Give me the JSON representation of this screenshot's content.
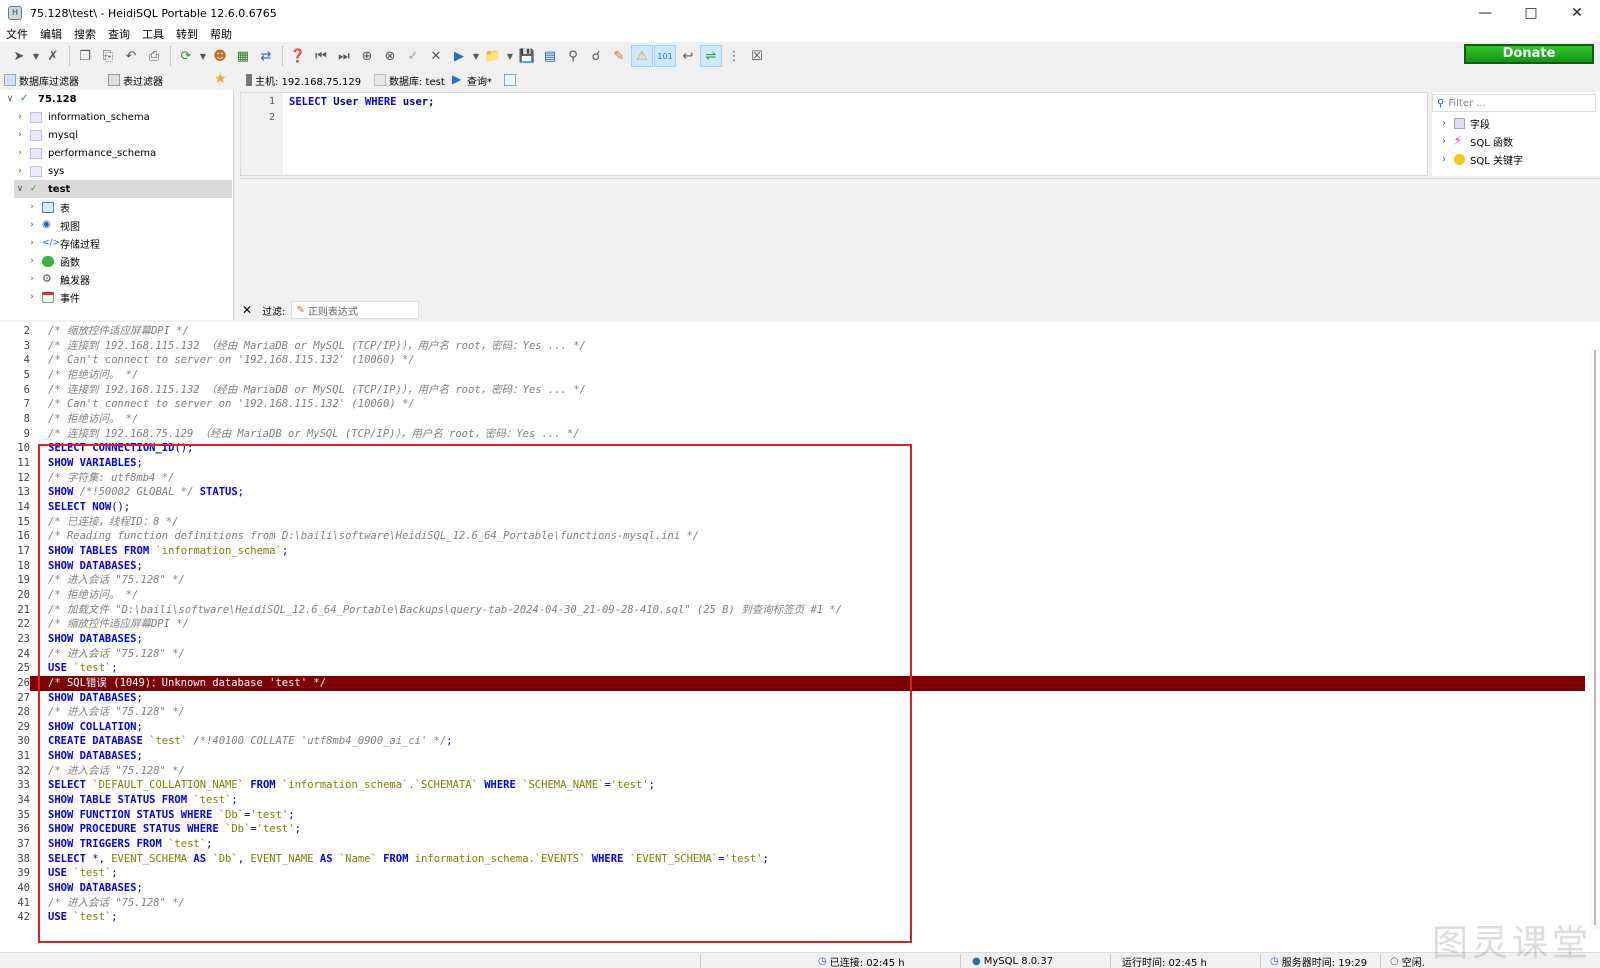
{
  "window": {
    "title": "75.128\\test\\ - HeidiSQL Portable 12.6.0.6765",
    "app_icon": "heidisql-icon"
  },
  "menu": [
    "文件",
    "编辑",
    "搜索",
    "查询",
    "工具",
    "转到",
    "帮助"
  ],
  "toolbar": {
    "donate_label": "Donate"
  },
  "tabs": {
    "db_filter": "数据库过滤器",
    "table_filter": "表过滤器",
    "host": "主机: 192.168.75.129",
    "database": "数据库: test",
    "query": "查询*"
  },
  "tree": {
    "root": "75.128",
    "databases": [
      "information_schema",
      "mysql",
      "performance_schema",
      "sys",
      "test"
    ],
    "selected": "test",
    "children": [
      "表",
      "视图",
      "存储过程",
      "函数",
      "触发器",
      "事件"
    ]
  },
  "editor": {
    "line_numbers": [
      "1",
      "2"
    ],
    "line1": {
      "kw1": "SELECT",
      "ident": "User",
      "kw2": "WHERE",
      "rest": "user;"
    }
  },
  "helpers": {
    "filter_placeholder": "Filter ...",
    "items": [
      "字段",
      "SQL 函数",
      "SQL 关键字"
    ]
  },
  "filterbar": {
    "label": "过滤:",
    "placeholder": "正则表达式"
  },
  "log": [
    {
      "n": "2",
      "parts": [
        [
          "c",
          "/* 缩放控件适应屏幕DPI */"
        ]
      ]
    },
    {
      "n": "3",
      "parts": [
        [
          "c",
          "/* 连接到 192.168.115.132 （经由 MariaDB or MySQL (TCP/IP)），用户名 root，密码：Yes ... */"
        ]
      ]
    },
    {
      "n": "4",
      "parts": [
        [
          "c",
          "/* Can't connect to server on '192.168.115.132' (10060) */"
        ]
      ]
    },
    {
      "n": "5",
      "parts": [
        [
          "c",
          "/* 拒绝访问。 */"
        ]
      ]
    },
    {
      "n": "6",
      "parts": [
        [
          "c",
          "/* 连接到 192.168.115.132 （经由 MariaDB or MySQL (TCP/IP)），用户名 root，密码：Yes ... */"
        ]
      ]
    },
    {
      "n": "7",
      "parts": [
        [
          "c",
          "/* Can't connect to server on '192.168.115.132' (10060) */"
        ]
      ]
    },
    {
      "n": "8",
      "parts": [
        [
          "c",
          "/* 拒绝访问。 */"
        ]
      ]
    },
    {
      "n": "9",
      "parts": [
        [
          "c",
          "/* 连接到 192.168.75.129 （经由 MariaDB or MySQL (TCP/IP)），用户名 root，密码：Yes ... */"
        ]
      ]
    },
    {
      "n": "10",
      "parts": [
        [
          "k",
          "SELECT CONNECTION_ID"
        ],
        [
          "p",
          "();"
        ]
      ]
    },
    {
      "n": "11",
      "parts": [
        [
          "k",
          "SHOW VARIABLES"
        ],
        [
          "p",
          ";"
        ]
      ]
    },
    {
      "n": "12",
      "parts": [
        [
          "c",
          "/* 字符集: utf8mb4 */"
        ]
      ]
    },
    {
      "n": "13",
      "parts": [
        [
          "k",
          "SHOW "
        ],
        [
          "c",
          "/*!50002 GLOBAL */"
        ],
        [
          "k",
          " STATUS"
        ],
        [
          "p",
          ";"
        ]
      ]
    },
    {
      "n": "14",
      "parts": [
        [
          "k",
          "SELECT NOW"
        ],
        [
          "p",
          "();"
        ]
      ]
    },
    {
      "n": "15",
      "parts": [
        [
          "c",
          "/* 已连接，线程ID：8 */"
        ]
      ]
    },
    {
      "n": "16",
      "parts": [
        [
          "c",
          "/* Reading function definitions from D:\\baili\\software\\HeidiSQL_12.6_64_Portable\\functions-mysql.ini */"
        ]
      ]
    },
    {
      "n": "17",
      "parts": [
        [
          "k",
          "SHOW TABLES FROM "
        ],
        [
          "s",
          "`information_schema`"
        ],
        [
          "p",
          ";"
        ]
      ]
    },
    {
      "n": "18",
      "parts": [
        [
          "k",
          "SHOW DATABASES"
        ],
        [
          "p",
          ";"
        ]
      ]
    },
    {
      "n": "19",
      "parts": [
        [
          "c",
          "/* 进入会话 \"75.128\" */"
        ]
      ]
    },
    {
      "n": "20",
      "parts": [
        [
          "c",
          "/* 拒绝访问。 */"
        ]
      ]
    },
    {
      "n": "21",
      "parts": [
        [
          "c",
          "/* 加载文件 \"D:\\baili\\software\\HeidiSQL_12.6_64_Portable\\Backups\\query-tab-2024-04-30_21-09-28-410.sql\" (25 B) 到查询标签页 #1 */"
        ]
      ]
    },
    {
      "n": "22",
      "parts": [
        [
          "c",
          "/* 缩放控件适应屏幕DPI */"
        ]
      ]
    },
    {
      "n": "23",
      "parts": [
        [
          "k",
          "SHOW DATABASES"
        ],
        [
          "p",
          ";"
        ]
      ]
    },
    {
      "n": "24",
      "parts": [
        [
          "c",
          "/* 进入会话 \"75.128\" */"
        ]
      ]
    },
    {
      "n": "25",
      "parts": [
        [
          "k",
          "USE "
        ],
        [
          "s",
          "`test`"
        ],
        [
          "p",
          ";"
        ]
      ]
    },
    {
      "n": "26",
      "err": true,
      "parts": [
        [
          "e",
          "/* SQL错误 (1049)：Unknown database 'test' */"
        ]
      ]
    },
    {
      "n": "27",
      "parts": [
        [
          "k",
          "SHOW DATABASES"
        ],
        [
          "p",
          ";"
        ]
      ]
    },
    {
      "n": "28",
      "parts": [
        [
          "c",
          "/* 进入会话 \"75.128\" */"
        ]
      ]
    },
    {
      "n": "29",
      "parts": [
        [
          "k",
          "SHOW COLLATION"
        ],
        [
          "p",
          ";"
        ]
      ]
    },
    {
      "n": "30",
      "parts": [
        [
          "k",
          "CREATE DATABASE "
        ],
        [
          "s",
          "`test` "
        ],
        [
          "c",
          "/*!40100 COLLATE 'utf8mb4_0900_ai_ci' */"
        ],
        [
          "p",
          ";"
        ]
      ]
    },
    {
      "n": "31",
      "parts": [
        [
          "k",
          "SHOW DATABASES"
        ],
        [
          "p",
          ";"
        ]
      ]
    },
    {
      "n": "32",
      "parts": [
        [
          "c",
          "/* 进入会话 \"75.128\" */"
        ]
      ]
    },
    {
      "n": "33",
      "parts": [
        [
          "k",
          "SELECT "
        ],
        [
          "s",
          "`DEFAULT_COLLATION_NAME` "
        ],
        [
          "k",
          "FROM "
        ],
        [
          "s",
          "`information_schema`.`SCHEMATA` "
        ],
        [
          "k",
          "WHERE "
        ],
        [
          "s",
          "`SCHEMA_NAME`"
        ],
        [
          "p",
          "="
        ],
        [
          "s",
          "'test'"
        ],
        [
          "p",
          ";"
        ]
      ]
    },
    {
      "n": "34",
      "parts": [
        [
          "k",
          "SHOW TABLE STATUS FROM "
        ],
        [
          "s",
          "`test`"
        ],
        [
          "p",
          ";"
        ]
      ]
    },
    {
      "n": "35",
      "parts": [
        [
          "k",
          "SHOW FUNCTION STATUS WHERE "
        ],
        [
          "s",
          "`Db`"
        ],
        [
          "p",
          "="
        ],
        [
          "s",
          "'test'"
        ],
        [
          "p",
          ";"
        ]
      ]
    },
    {
      "n": "36",
      "parts": [
        [
          "k",
          "SHOW PROCEDURE STATUS WHERE "
        ],
        [
          "s",
          "`Db`"
        ],
        [
          "p",
          "="
        ],
        [
          "s",
          "'test'"
        ],
        [
          "p",
          ";"
        ]
      ]
    },
    {
      "n": "37",
      "parts": [
        [
          "k",
          "SHOW TRIGGERS FROM "
        ],
        [
          "s",
          "`test`"
        ],
        [
          "p",
          ";"
        ]
      ]
    },
    {
      "n": "38",
      "parts": [
        [
          "k",
          "SELECT "
        ],
        [
          "p",
          "*, "
        ],
        [
          "s",
          "EVENT_SCHEMA "
        ],
        [
          "k",
          "AS "
        ],
        [
          "s",
          "`Db`"
        ],
        [
          "p",
          ", "
        ],
        [
          "s",
          "EVENT_NAME "
        ],
        [
          "k",
          "AS "
        ],
        [
          "s",
          "`Name` "
        ],
        [
          "k",
          "FROM "
        ],
        [
          "s",
          "information_schema.`EVENTS` "
        ],
        [
          "k",
          "WHERE "
        ],
        [
          "s",
          "`EVENT_SCHEMA`"
        ],
        [
          "p",
          "="
        ],
        [
          "s",
          "'test'"
        ],
        [
          "p",
          ";"
        ]
      ]
    },
    {
      "n": "39",
      "parts": [
        [
          "k",
          "USE "
        ],
        [
          "s",
          "`test`"
        ],
        [
          "p",
          ";"
        ]
      ]
    },
    {
      "n": "40",
      "parts": [
        [
          "k",
          "SHOW DATABASES"
        ],
        [
          "p",
          ";"
        ]
      ]
    },
    {
      "n": "41",
      "parts": [
        [
          "c",
          "/* 进入会话 \"75.128\" */"
        ]
      ]
    },
    {
      "n": "42",
      "parts": [
        [
          "k",
          "USE "
        ],
        [
          "s",
          "`test`"
        ],
        [
          "p",
          ";"
        ]
      ]
    }
  ],
  "status": {
    "connected": "已连接: 02:45 h",
    "server": "MySQL 8.0.37",
    "uptime": "运行时间: 02:45 h",
    "server_time": "服务器时间: 19:29",
    "idle": "空闲."
  },
  "watermark": "图灵课堂",
  "colors": {
    "error_row": "#800000",
    "keyword": "#0000ff",
    "comment": "#808080",
    "string": "#808000",
    "highlight_box": "#e02020",
    "donate": "#1bb01b"
  }
}
